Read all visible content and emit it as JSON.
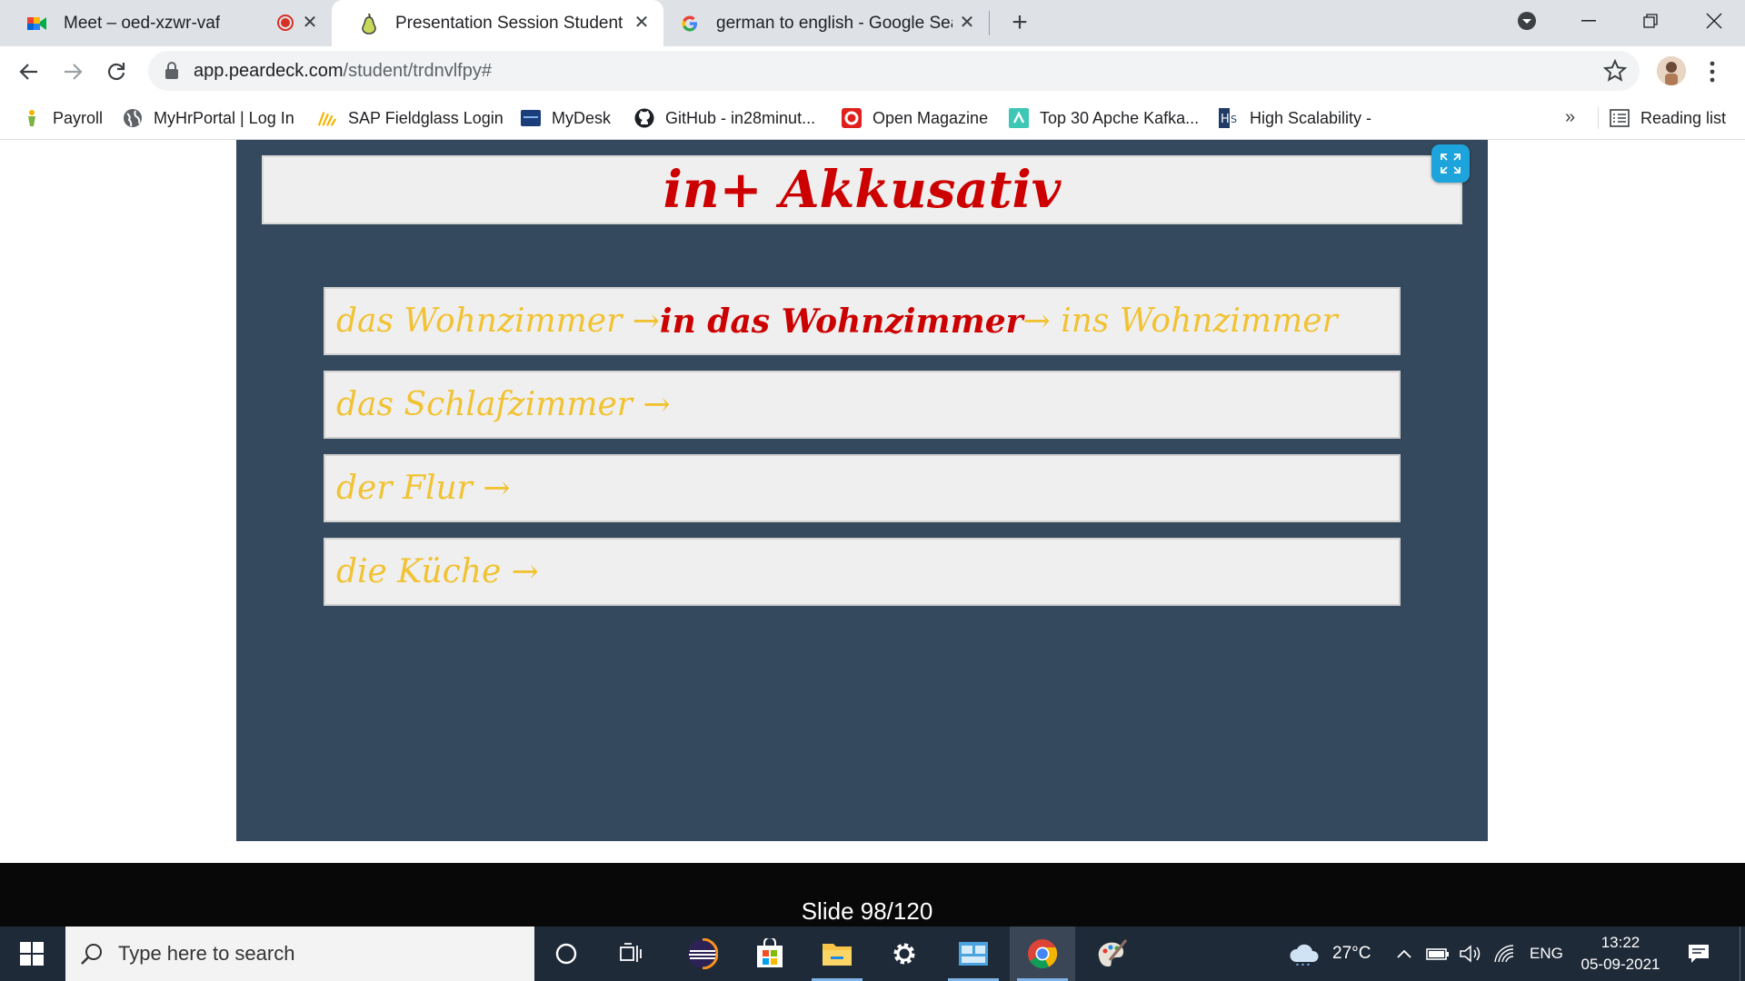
{
  "browser": {
    "tabs": [
      {
        "title": "Meet – oed-xzwr-vaf",
        "icon": "google-meet-icon",
        "recording": true,
        "active": false
      },
      {
        "title": "Presentation Session Student",
        "icon": "pear-deck-icon",
        "active": true
      },
      {
        "title": "german to english - Google Search",
        "icon": "google-icon",
        "active": false
      }
    ],
    "url_domain": "app.peardeck.com",
    "url_path": "/student/trdnvlfpy#",
    "bookmarks": [
      {
        "label": "Payroll",
        "icon": "payroll-icon"
      },
      {
        "label": "MyHrPortal | Log In",
        "icon": "globe-icon"
      },
      {
        "label": "SAP Fieldglass Login",
        "icon": "fieldglass-icon"
      },
      {
        "label": "MyDesk",
        "icon": "mydesk-icon"
      },
      {
        "label": "GitHub - in28minut...",
        "icon": "github-icon"
      },
      {
        "label": "Open Magazine",
        "icon": "open-magazine-icon"
      },
      {
        "label": "Top 30 Apche Kafka...",
        "icon": "kafka-icon"
      },
      {
        "label": "High Scalability -",
        "icon": "high-scalability-icon"
      }
    ],
    "bookmarks_overflow": "»",
    "reading_list": "Reading list"
  },
  "slide": {
    "title": "in+ Akkusativ",
    "rows": [
      {
        "parts": [
          {
            "text": "das Wohnzimmer → ",
            "style": "y"
          },
          {
            "text": "in das Wohnzimmer",
            "style": "r"
          },
          {
            "text": " → ins Wohnzimmer",
            "style": "y"
          }
        ]
      },
      {
        "parts": [
          {
            "text": "das Schlafzimmer →",
            "style": "y"
          }
        ]
      },
      {
        "parts": [
          {
            "text": "der Flur →",
            "style": "y"
          }
        ]
      },
      {
        "parts": [
          {
            "text": "die Küche →",
            "style": "y"
          }
        ]
      }
    ],
    "counter": "Slide 98/120"
  },
  "taskbar": {
    "search_placeholder": "Type here to search",
    "weather": "27°C",
    "language": "ENG",
    "time": "13:22",
    "date": "05-09-2021"
  },
  "colors": {
    "slide_bg": "#34495e",
    "title_red": "#cc0000",
    "row_yellow": "#f1c232",
    "expand_blue": "#1ea4dc"
  }
}
